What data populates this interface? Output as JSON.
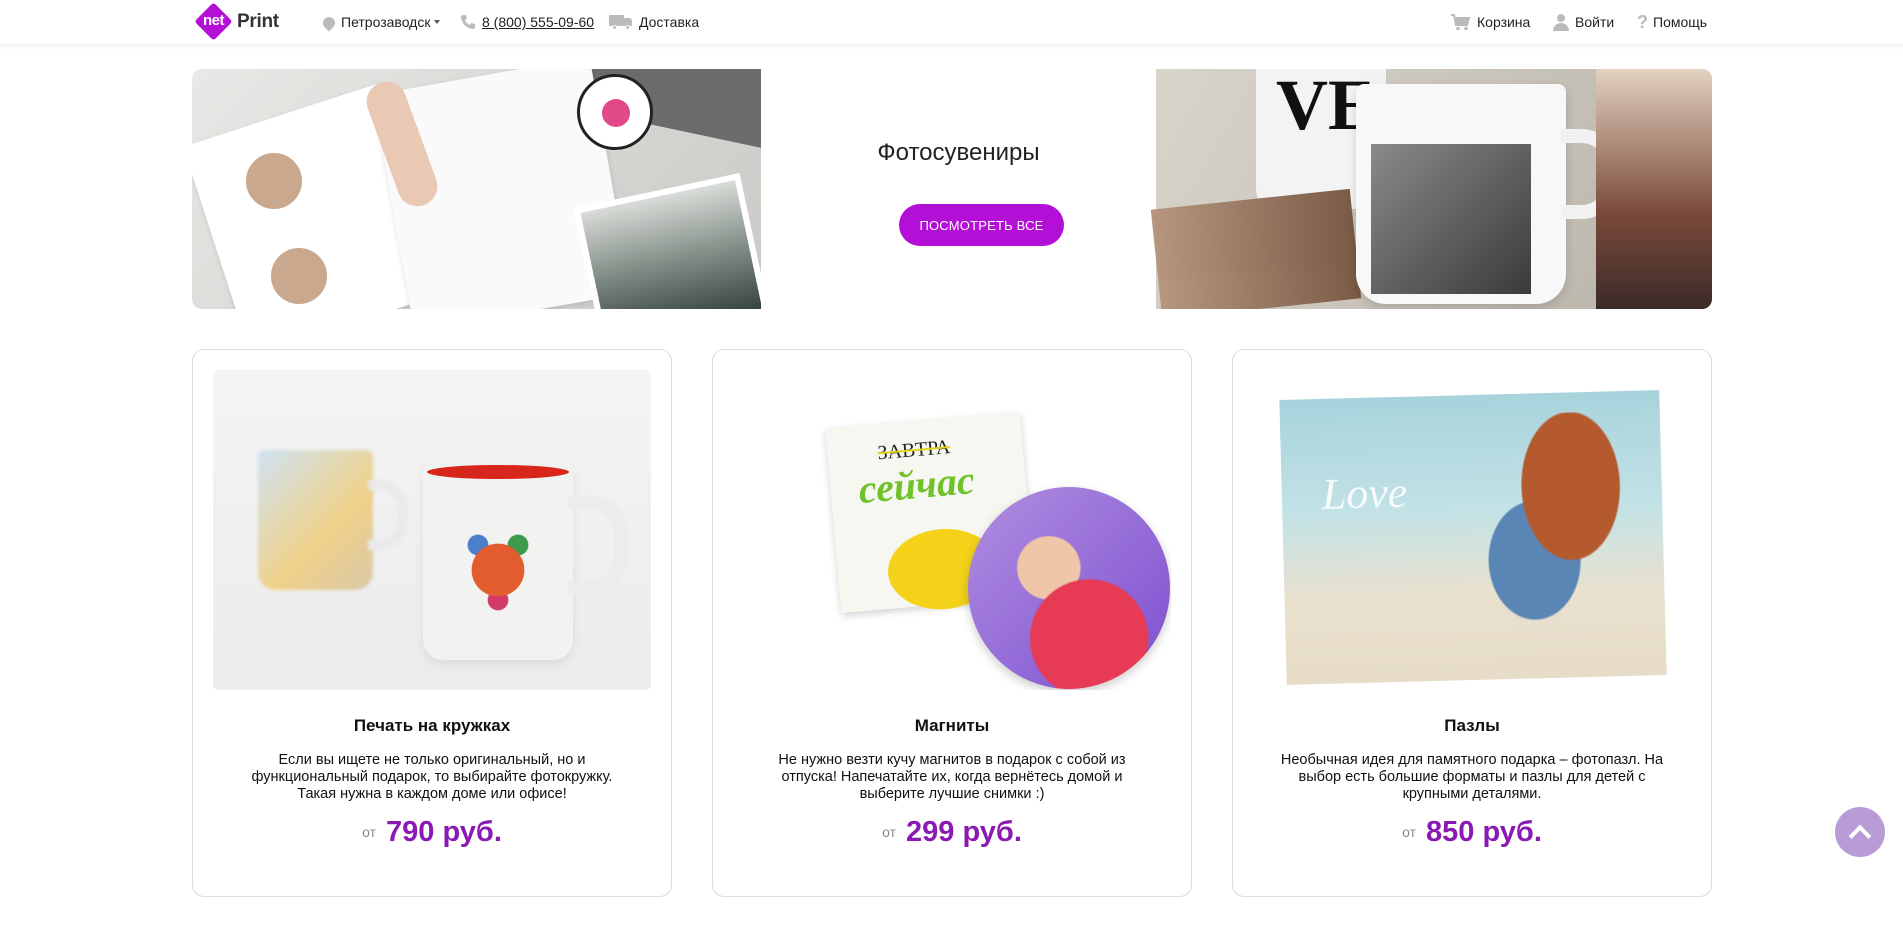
{
  "header": {
    "logo_prefix": "net",
    "logo_suffix": "Print",
    "city": "Петрозаводск",
    "phone": "8 (800) 555-09-60",
    "delivery": "Доставка",
    "cart": "Корзина",
    "login": "Войти",
    "help": "Помощь"
  },
  "banner": {
    "title": "Фотосувениры",
    "button": "ПОСМОТРЕТЬ ВСЕ"
  },
  "cards": [
    {
      "title": "Печать на кружках",
      "description": "Если вы ищете не только оригинальный, но и функциональный подарок, то выбирайте фотокружку. Такая нужна в каждом доме или офисе!",
      "price_prefix": "от",
      "price": "790 руб."
    },
    {
      "title": "Магниты",
      "description": "Не нужно везти кучу магнитов в подарок с собой из отпуска! Напечатайте их, когда вернётесь домой и выберите лучшие снимки :)",
      "price_prefix": "от",
      "price": "299 руб."
    },
    {
      "title": "Пазлы",
      "description": "Необычная идея для памятного подарка – фотопазл. На выбор есть большие форматы и пазлы для детей с крупными деталями.",
      "price_prefix": "от",
      "price": "850 руб."
    }
  ],
  "images": {
    "magnet_word_crossed": "ЗАВТРА",
    "magnet_word": "сейчас",
    "puzzle_text": "Love"
  },
  "colors": {
    "accent": "#b40fd7",
    "price": "#8a1ab2",
    "scroll_top": "#b99bd8"
  },
  "icons": [
    "location-icon",
    "phone-icon",
    "truck-icon",
    "cart-icon",
    "user-icon",
    "help-icon",
    "chevron-up-icon"
  ]
}
